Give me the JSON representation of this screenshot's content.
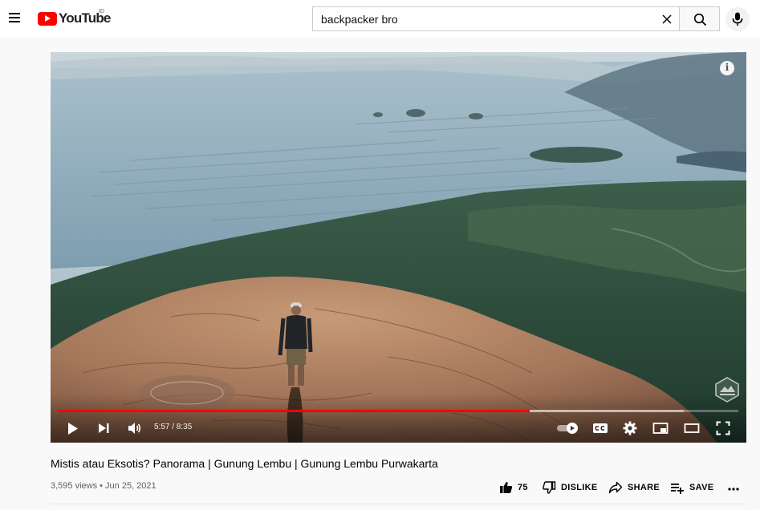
{
  "header": {
    "logo_text": "YouTube",
    "logo_region": "ID",
    "search_value": "backpacker bro"
  },
  "player": {
    "current_time": "5:57",
    "duration": "8:35",
    "time_text": "5:57 / 8:35",
    "progress_played": 0.6933,
    "progress_loaded": 0.92
  },
  "video": {
    "title": "Mistis atau Eksotis? Panorama | Gunung Lembu | Gunung Lembu Purwakarta",
    "views": "3,595 views",
    "date": "Jun 25, 2021",
    "meta_text": "3,595 views • Jun 25, 2021"
  },
  "actions": {
    "like_count": "75",
    "dislike_label": "DISLIKE",
    "share_label": "SHARE",
    "save_label": "SAVE"
  },
  "colors": {
    "brand_red": "#ff0000",
    "progress_played": "#ff0000"
  },
  "icons": {
    "menu": "hamburger-icon",
    "search": "search-icon",
    "mic": "microphone-icon",
    "info": "info-icon",
    "play": "play-icon",
    "next": "next-icon",
    "volume": "volume-icon",
    "autoplay": "autoplay-toggle-icon",
    "captions": "captions-icon",
    "settings": "gear-icon",
    "miniplayer": "miniplayer-icon",
    "theater": "theater-mode-icon",
    "fullscreen": "fullscreen-icon",
    "like": "thumbs-up-icon",
    "dislike": "thumbs-down-icon",
    "share": "share-icon",
    "save": "playlist-add-icon",
    "more": "more-icon"
  }
}
